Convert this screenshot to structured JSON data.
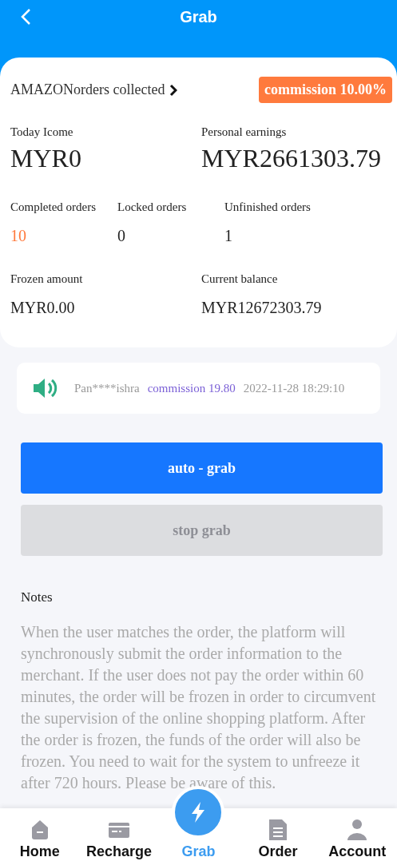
{
  "header": {
    "title": "Grab"
  },
  "card": {
    "title": "AMAZONorders collected",
    "badge": "commission 10.00%",
    "rows": [
      [
        {
          "label": "Today Icome",
          "value": "MYR0",
          "color": "#222222"
        },
        {
          "label": "Personal earnings",
          "value": "MYR2661303.79",
          "color": "#222222"
        }
      ],
      [
        {
          "label": "Completed orders",
          "value": "10",
          "color": "#ff7a3d"
        },
        {
          "label": "Locked orders",
          "value": "0",
          "color": "#222222"
        },
        {
          "label": "Unfinished orders",
          "value": "1",
          "color": "#222222"
        }
      ],
      [
        {
          "label": "Frozen amount",
          "value": "MYR0.00",
          "color": "#222222"
        },
        {
          "label": "Current balance",
          "value": "MYR12672303.79",
          "color": "#222222"
        }
      ]
    ]
  },
  "notice": {
    "user": "Pan****ishra",
    "commission": "commission 19.80",
    "time": "2022-11-28 18:29:10"
  },
  "buttons": [
    {
      "label": "auto - grab",
      "disabled": false
    },
    {
      "label": "stop grab",
      "disabled": true
    }
  ],
  "notes": {
    "title": "Notes",
    "text": "When the user matches the order, the platform will synchronously submit the order information to the merchant. If the user does not pay the order within 60 minutes, the order will be frozen in order to circumvent the supervision of the online shopping platform. After the order is frozen, the funds of the order will also be frozen. You need to wait for the system to unfreeze it after 720 hours. Please be aware of this."
  },
  "tabs": [
    {
      "label": "Home",
      "kind": "home",
      "selected": false
    },
    {
      "label": "Recharge",
      "kind": "card",
      "selected": false
    },
    {
      "label": "Grab",
      "kind": "bolt",
      "selected": true
    },
    {
      "label": "Order",
      "kind": "doc",
      "selected": false
    },
    {
      "label": "Account",
      "kind": "person",
      "selected": false
    }
  ]
}
